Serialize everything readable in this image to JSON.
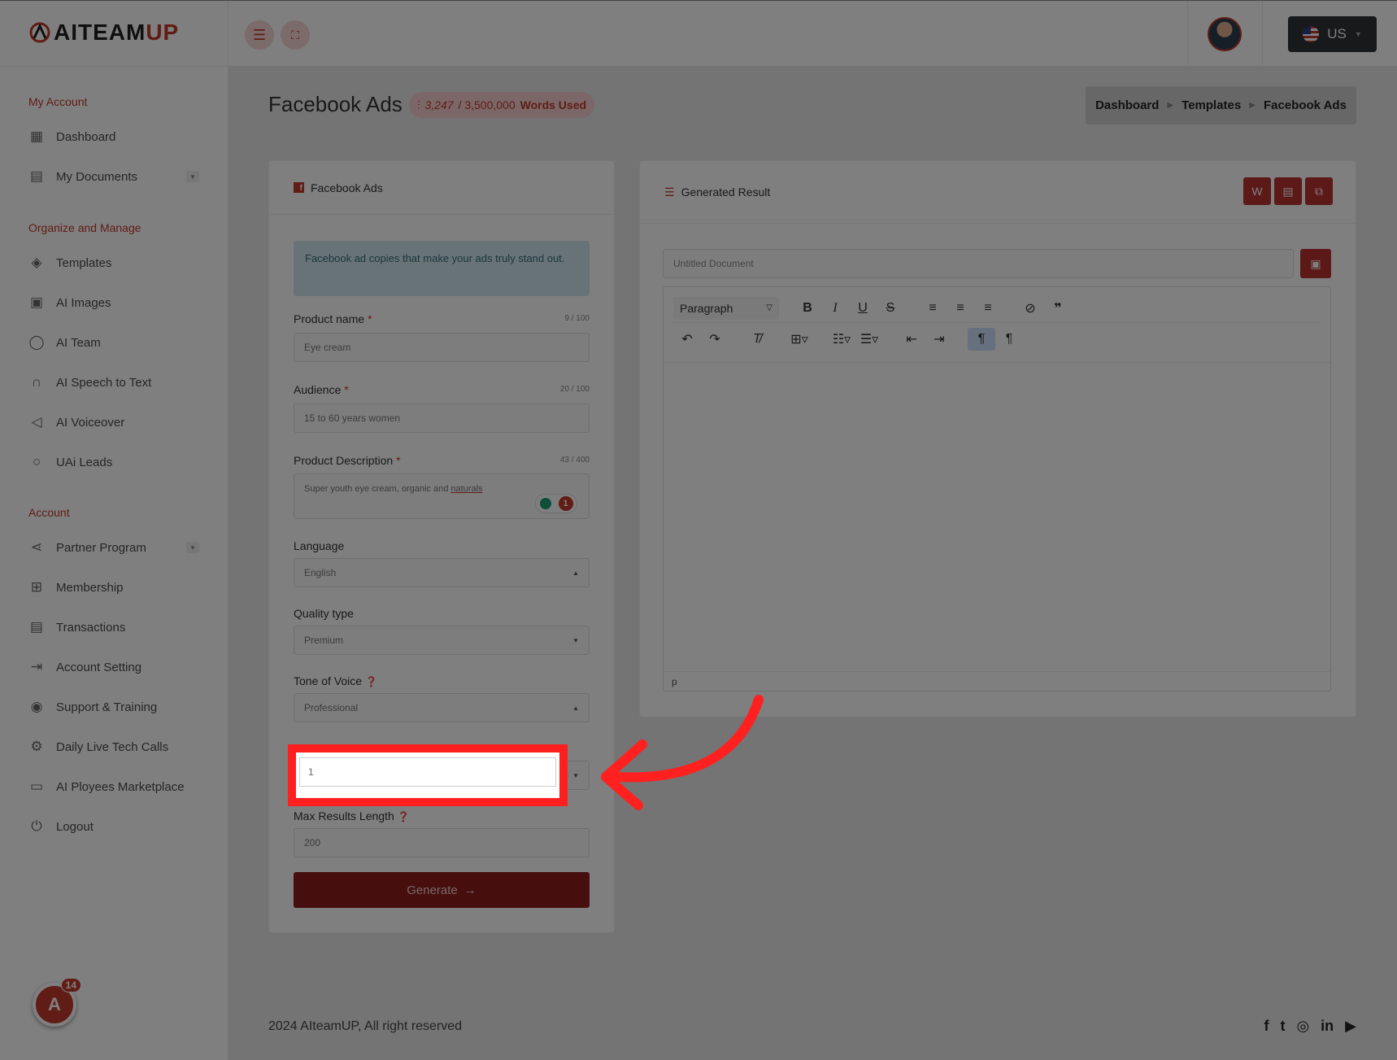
{
  "app": {
    "brand_main": "AITEAM",
    "brand_accent": "UP",
    "accent_color": "#c0392b"
  },
  "topbar": {
    "lang_label": "US",
    "menu_icon": "menu-icon",
    "fullscreen_icon": "fullscreen-icon"
  },
  "sidebar": {
    "sections": [
      {
        "title": "My Account",
        "items": [
          {
            "label": "Dashboard",
            "icon": "grid-icon"
          },
          {
            "label": "My Documents",
            "icon": "document-icon",
            "has_caret": true
          }
        ]
      },
      {
        "title": "Organize and Manage",
        "items": [
          {
            "label": "Templates",
            "icon": "layers-icon"
          },
          {
            "label": "AI Images",
            "icon": "image-icon"
          },
          {
            "label": "AI Team",
            "icon": "chat-icon"
          },
          {
            "label": "AI Speech to Text",
            "icon": "headphones-icon"
          },
          {
            "label": "AI Voiceover",
            "icon": "speaker-icon"
          },
          {
            "label": "UAi Leads",
            "icon": "circle-icon"
          }
        ]
      },
      {
        "title": "Account",
        "items": [
          {
            "label": "Partner Program",
            "icon": "share-icon",
            "has_caret": true
          },
          {
            "label": "Membership",
            "icon": "gift-icon"
          },
          {
            "label": "Transactions",
            "icon": "receipt-icon"
          },
          {
            "label": "Account Setting",
            "icon": "logout-arrow-icon"
          },
          {
            "label": "Support & Training",
            "icon": "eye-icon"
          },
          {
            "label": "Daily Live Tech Calls",
            "icon": "gear-icon"
          },
          {
            "label": "AI Ployees Marketplace",
            "icon": "monitor-icon"
          },
          {
            "label": "Logout",
            "icon": "power-icon"
          }
        ]
      }
    ],
    "fab_badge": "14"
  },
  "header": {
    "title": "Facebook Ads",
    "words_used": "3,247",
    "words_total": "/ 3,500,000",
    "words_label": "Words Used",
    "breadcrumb": [
      "Dashboard",
      "Templates",
      "Facebook Ads"
    ]
  },
  "form": {
    "card_title": "Facebook Ads",
    "info": "Facebook ad copies that make your ads truly stand out.",
    "product_name": {
      "label": "Product name",
      "counter": "9 / 100",
      "value": "Eye cream"
    },
    "audience": {
      "label": "Audience",
      "counter": "20 / 100",
      "value": "15 to 60 years women"
    },
    "description": {
      "label": "Product Description",
      "counter": "43 / 400",
      "value_main": "Super youth eye cream, organic and ",
      "value_flagged": "naturals",
      "grammar_count": "1"
    },
    "language": {
      "label": "Language",
      "value": "English"
    },
    "quality": {
      "label": "Quality type",
      "value": "Premium"
    },
    "tone": {
      "label": "Tone of Voice",
      "value": "Professional"
    },
    "results": {
      "value": "1"
    },
    "max_length": {
      "label": "Max Results Length",
      "value": "200"
    },
    "generate_label": "Generate"
  },
  "result": {
    "card_title": "Generated Result",
    "doc_placeholder": "Untitled Document",
    "paragraph_select": "Paragraph",
    "status_path": "p"
  },
  "footer": {
    "text": "2024 AIteamUP, All right reserved",
    "social": [
      "f",
      "t",
      "ig",
      "in",
      "yt"
    ]
  }
}
